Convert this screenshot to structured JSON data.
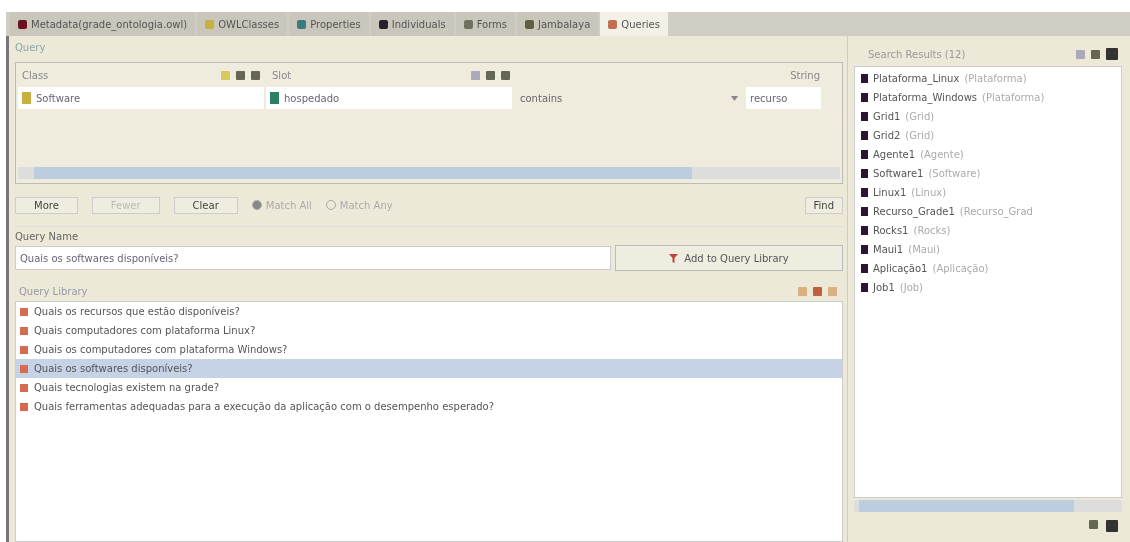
{
  "tabs": [
    {
      "label": "Metadata(grade_ontologia.owl)",
      "color": "#6a1020",
      "selected": false
    },
    {
      "label": "OWLClasses",
      "color": "#c8b040",
      "selected": false
    },
    {
      "label": "Properties",
      "color": "#3a7a80",
      "selected": false
    },
    {
      "label": "Individuals",
      "color": "#2a2030",
      "selected": false
    },
    {
      "label": "Forms",
      "color": "#707060",
      "selected": false
    },
    {
      "label": "Jambalaya",
      "color": "#606040",
      "selected": false
    },
    {
      "label": "Queries",
      "color": "#c07050",
      "selected": true
    }
  ],
  "query": {
    "title": "Query",
    "class_label": "Class",
    "slot_label": "Slot",
    "strings_label": "String",
    "class_value": "Software",
    "slot_value": "hospedado",
    "operator": "contains",
    "string_value": "recurso",
    "buttons": [
      {
        "label": "More",
        "disabled": false
      },
      {
        "label": "Fewer",
        "disabled": true
      },
      {
        "label": "Clear",
        "disabled": false
      }
    ],
    "match": [
      {
        "label": "Match All",
        "selected": true
      },
      {
        "label": "Match Any",
        "selected": false
      }
    ],
    "find": "Find"
  },
  "query_name": {
    "label": "Query Name",
    "value": "Quais os softwares disponíveis?",
    "add_button": "Add to Query Library"
  },
  "library": {
    "title": "Query Library",
    "items": [
      {
        "text": "Quais os recursos que estão disponíveis?",
        "selected": false
      },
      {
        "text": "Quais computadores com plataforma Linux?",
        "selected": false
      },
      {
        "text": "Quais os computadores com plataforma Windows?",
        "selected": false
      },
      {
        "text": "Quais os softwares disponíveis?",
        "selected": true
      },
      {
        "text": "Quais tecnologias existem na grade?",
        "selected": false
      },
      {
        "text": "Quais ferramentas adequadas para a execução da aplicação com o desempenho esperado?",
        "selected": false
      }
    ]
  },
  "results": {
    "title": "Search Results (12)",
    "items": [
      {
        "name": "Plataforma_Linux",
        "type": "(Plataforma)"
      },
      {
        "name": "Plataforma_Windows",
        "type": "(Plataforma)"
      },
      {
        "name": "Grid1",
        "type": "(Grid)"
      },
      {
        "name": "Grid2",
        "type": "(Grid)"
      },
      {
        "name": "Agente1",
        "type": "(Agente)"
      },
      {
        "name": "Software1",
        "type": "(Software)"
      },
      {
        "name": "Linux1",
        "type": "(Linux)"
      },
      {
        "name": "Recurso_Grade1",
        "type": "(Recurso_Grad"
      },
      {
        "name": "Rocks1",
        "type": "(Rocks)"
      },
      {
        "name": "Maui1",
        "type": "(Maui)"
      },
      {
        "name": "Aplicação1",
        "type": "(Aplicação)"
      },
      {
        "name": "Job1",
        "type": "(Job)"
      }
    ]
  }
}
